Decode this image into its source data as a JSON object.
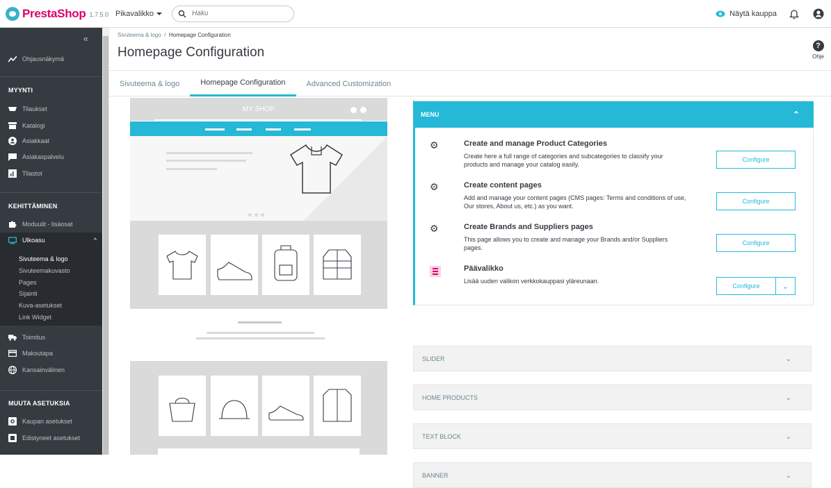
{
  "app": {
    "brand": "PrestaShop",
    "version": "1.7.5.0"
  },
  "topbar": {
    "quick_access": "Pikavalikko",
    "search_placeholder": "Haku",
    "view_shop": "Näytä kauppa"
  },
  "sidebar": {
    "dashboard": "Ohjausnäkymä",
    "sections": [
      {
        "title": "MYYNTI",
        "items": [
          "Tilaukset",
          "Katalogi",
          "Asiakkaat",
          "Asiakaspalvelu",
          "Tilastot"
        ]
      },
      {
        "title": "KEHITTÄMINEN",
        "items": [
          "Moduulit - lisäosat",
          "Ulkoasu"
        ]
      },
      {
        "title": "MUUTA ASETUKSIA",
        "items": [
          "Kaupan asetukset",
          "Edistyneet asetukset"
        ]
      }
    ],
    "ulkoasu_sub": [
      "Sivuteema & logo",
      "Sivuteemakuvasto",
      "Pages",
      "Sijainti",
      "Kuva-asetukset",
      "Link Widget"
    ],
    "after": [
      "Toimitus",
      "Maksutapa",
      "Kansainvälinen"
    ]
  },
  "header": {
    "breadcrumb_parent": "Sivuteema & logo",
    "breadcrumb_sep": "/",
    "breadcrumb_current": "Homepage Configuration",
    "title": "Homepage Configuration",
    "help": "Ohje"
  },
  "tabs": [
    "Sivuteema & logo",
    "Homepage Configuration",
    "Advanced Customization"
  ],
  "preview": {
    "shop_name": "MY SHOP"
  },
  "menu_panel": {
    "title": "MENU",
    "rows": [
      {
        "title": "Create and manage Product Categories",
        "desc": "Create here a full range of categories and subcategories to classify your products and manage your catalog easily.",
        "button": "Configure"
      },
      {
        "title": "Create content pages",
        "desc": "Add and manage your content pages (CMS pages: Terms and conditions of use, Our stores, About us, etc.) as you want.",
        "button": "Configure"
      },
      {
        "title": "Create Brands and Suppliers pages",
        "desc": "This page allows you to create and manage your Brands and/or Suppliers pages.",
        "button": "Configure"
      },
      {
        "title": "Päävalikko",
        "desc": "Lisää uuden valikon verkkokauppasi yläreunaan.",
        "button": "Configure"
      }
    ]
  },
  "collapsed_panels": [
    "SLIDER",
    "HOME PRODUCTS",
    "TEXT BLOCK",
    "BANNER"
  ],
  "colors": {
    "accent": "#25b9d7",
    "brand": "#df0067",
    "sidebar": "#363a41"
  }
}
